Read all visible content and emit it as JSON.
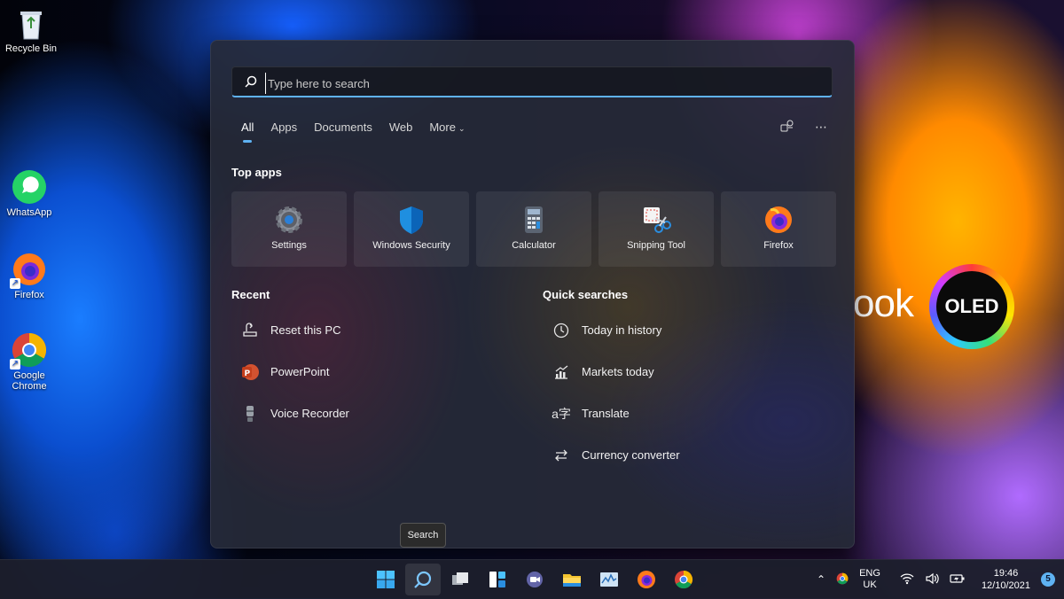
{
  "desktop": {
    "icons": [
      {
        "label": "Recycle Bin"
      },
      {
        "label": "WhatsApp"
      },
      {
        "label": "Firefox"
      },
      {
        "label": "Google Chrome"
      }
    ],
    "brand_text": "ook",
    "oled_badge": "OLED"
  },
  "search": {
    "placeholder": "Type here to search",
    "tabs": [
      {
        "label": "All",
        "active": true
      },
      {
        "label": "Apps"
      },
      {
        "label": "Documents"
      },
      {
        "label": "Web"
      },
      {
        "label": "More"
      }
    ],
    "top_apps_title": "Top apps",
    "top_apps": [
      {
        "label": "Settings",
        "icon": "gear-icon"
      },
      {
        "label": "Windows Security",
        "icon": "shield-icon"
      },
      {
        "label": "Calculator",
        "icon": "calculator-icon"
      },
      {
        "label": "Snipping Tool",
        "icon": "scissors-icon"
      },
      {
        "label": "Firefox",
        "icon": "firefox-icon"
      }
    ],
    "recent_title": "Recent",
    "recent": [
      {
        "label": "Reset this PC",
        "icon": "reset-pc-icon"
      },
      {
        "label": "PowerPoint",
        "icon": "powerpoint-icon"
      },
      {
        "label": "Voice Recorder",
        "icon": "microphone-icon"
      }
    ],
    "quick_title": "Quick searches",
    "quick": [
      {
        "label": "Today in history",
        "icon": "clock-icon"
      },
      {
        "label": "Markets today",
        "icon": "chart-icon"
      },
      {
        "label": "Translate",
        "icon": "translate-icon"
      },
      {
        "label": "Currency converter",
        "icon": "exchange-icon"
      }
    ]
  },
  "tooltip": "Search",
  "taskbar": {
    "lang_top": "ENG",
    "lang_bottom": "UK",
    "time": "19:46",
    "date": "12/10/2021",
    "notifications": "5"
  },
  "colors": {
    "accent": "#5fb2f2",
    "panel": "#262a38"
  }
}
